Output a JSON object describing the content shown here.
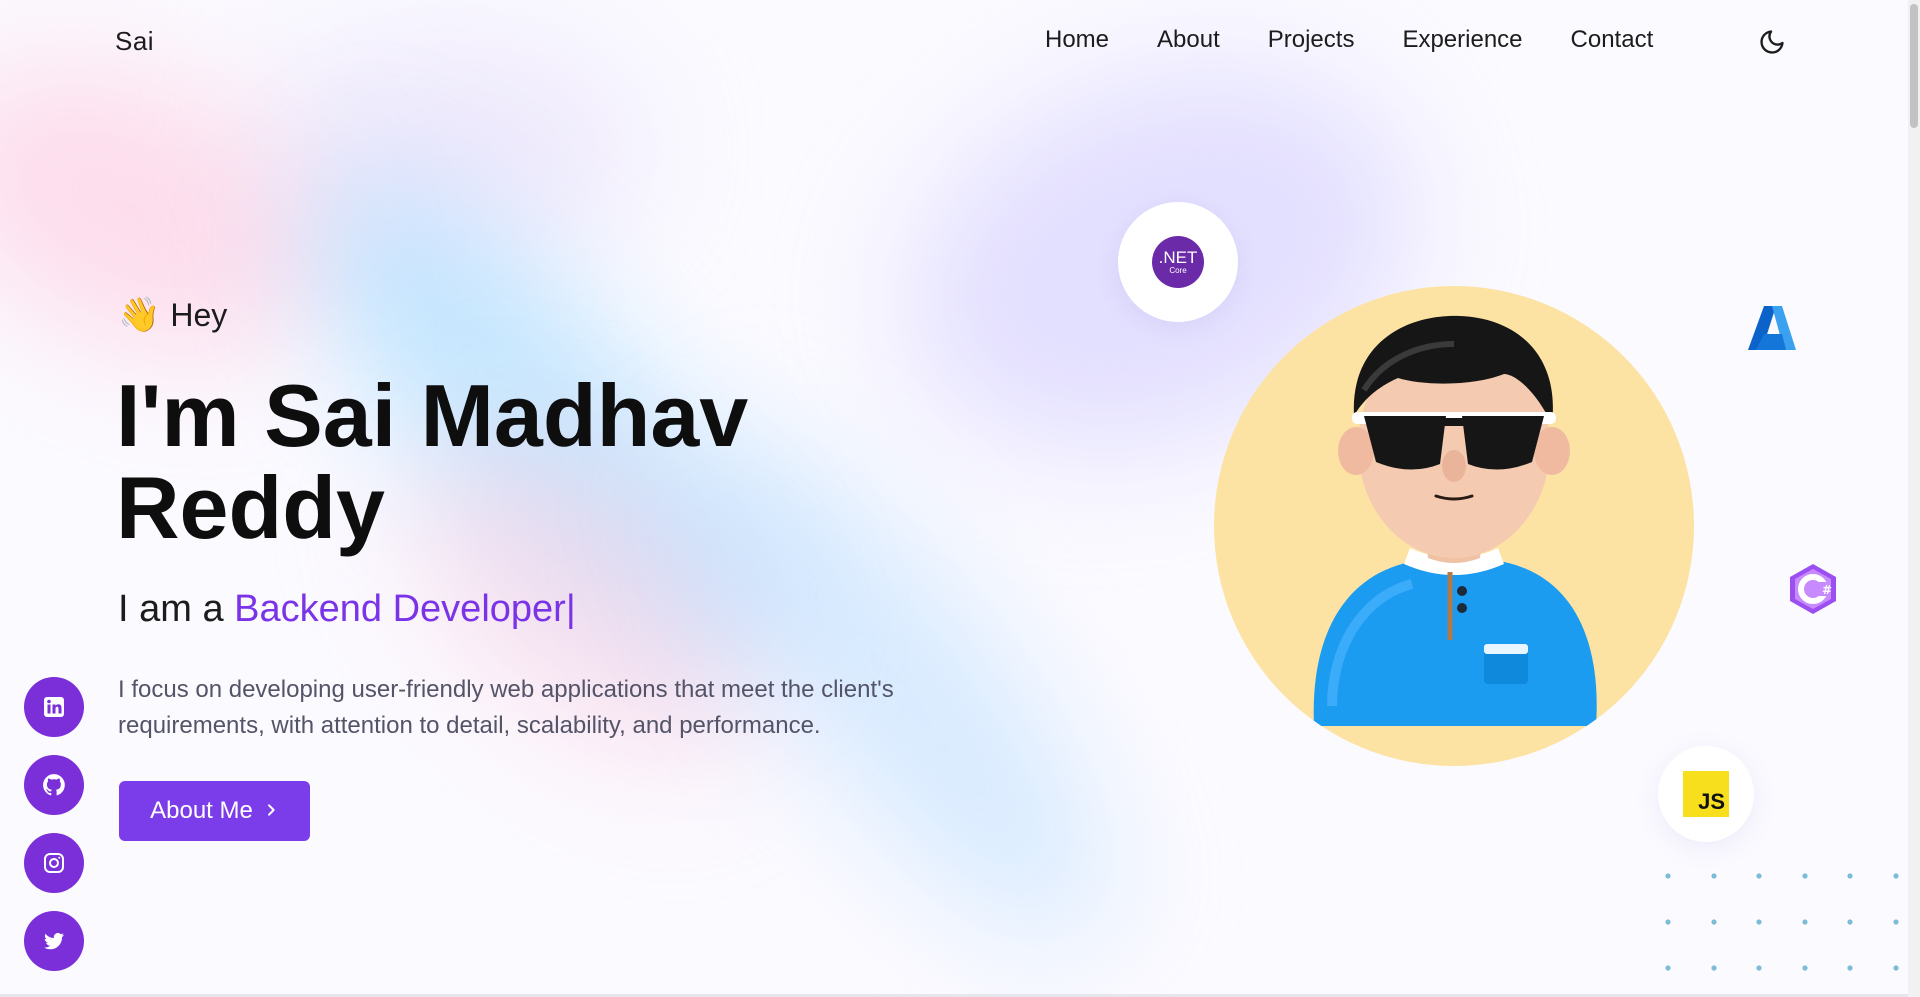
{
  "nav": {
    "logo": "Sai",
    "links": [
      "Home",
      "About",
      "Projects",
      "Experience",
      "Contact"
    ],
    "theme_icon": "moon-icon"
  },
  "hero": {
    "greeting_emoji": "👋",
    "greeting": "Hey",
    "name_line1": "I'm Sai Madhav",
    "name_line2": "Reddy",
    "role_prefix": "I am a",
    "role_highlight": "Backend Developer",
    "role_caret": "|",
    "description": "I focus on developing user-friendly web applications that meet the client's requirements, with attention to detail, scalability, and performance.",
    "cta_label": "About Me",
    "cta_icon": "chevron-right-icon"
  },
  "socials": [
    {
      "name": "linkedin-icon"
    },
    {
      "name": "github-icon"
    },
    {
      "name": "instagram-icon"
    },
    {
      "name": "twitter-icon"
    }
  ],
  "tech_badges": {
    "dotnet": {
      "label": ".NET",
      "sub": "Core"
    },
    "azure": {
      "icon": "azure-icon"
    },
    "csharp": {
      "icon": "csharp-icon"
    },
    "js": {
      "label": "JS"
    }
  },
  "colors": {
    "accent": "#7a33e6",
    "button": "#7b3de9",
    "social": "#7a2fd9",
    "avatar_bg": "#fce3a4"
  }
}
